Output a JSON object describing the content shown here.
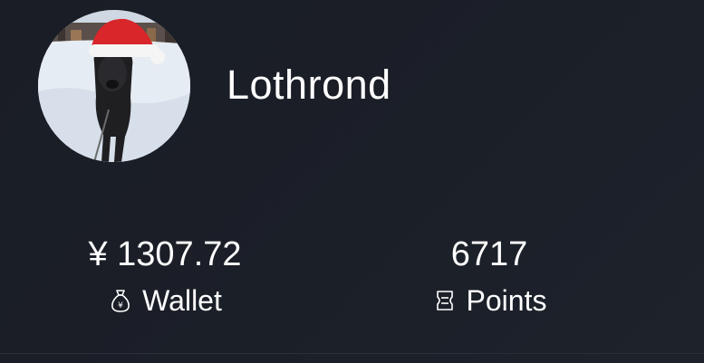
{
  "profile": {
    "username": "Lothrond",
    "avatar_icon": "avatar-dog-santa-hat"
  },
  "stats": {
    "wallet": {
      "value": "¥ 1307.72",
      "label": "Wallet",
      "icon": "money-bag-icon"
    },
    "points": {
      "value": "6717",
      "label": "Points",
      "icon": "ticket-icon"
    }
  },
  "colors": {
    "background": "#1b1f28",
    "text": "#ffffff",
    "santa_hat_red": "#d8262a"
  }
}
